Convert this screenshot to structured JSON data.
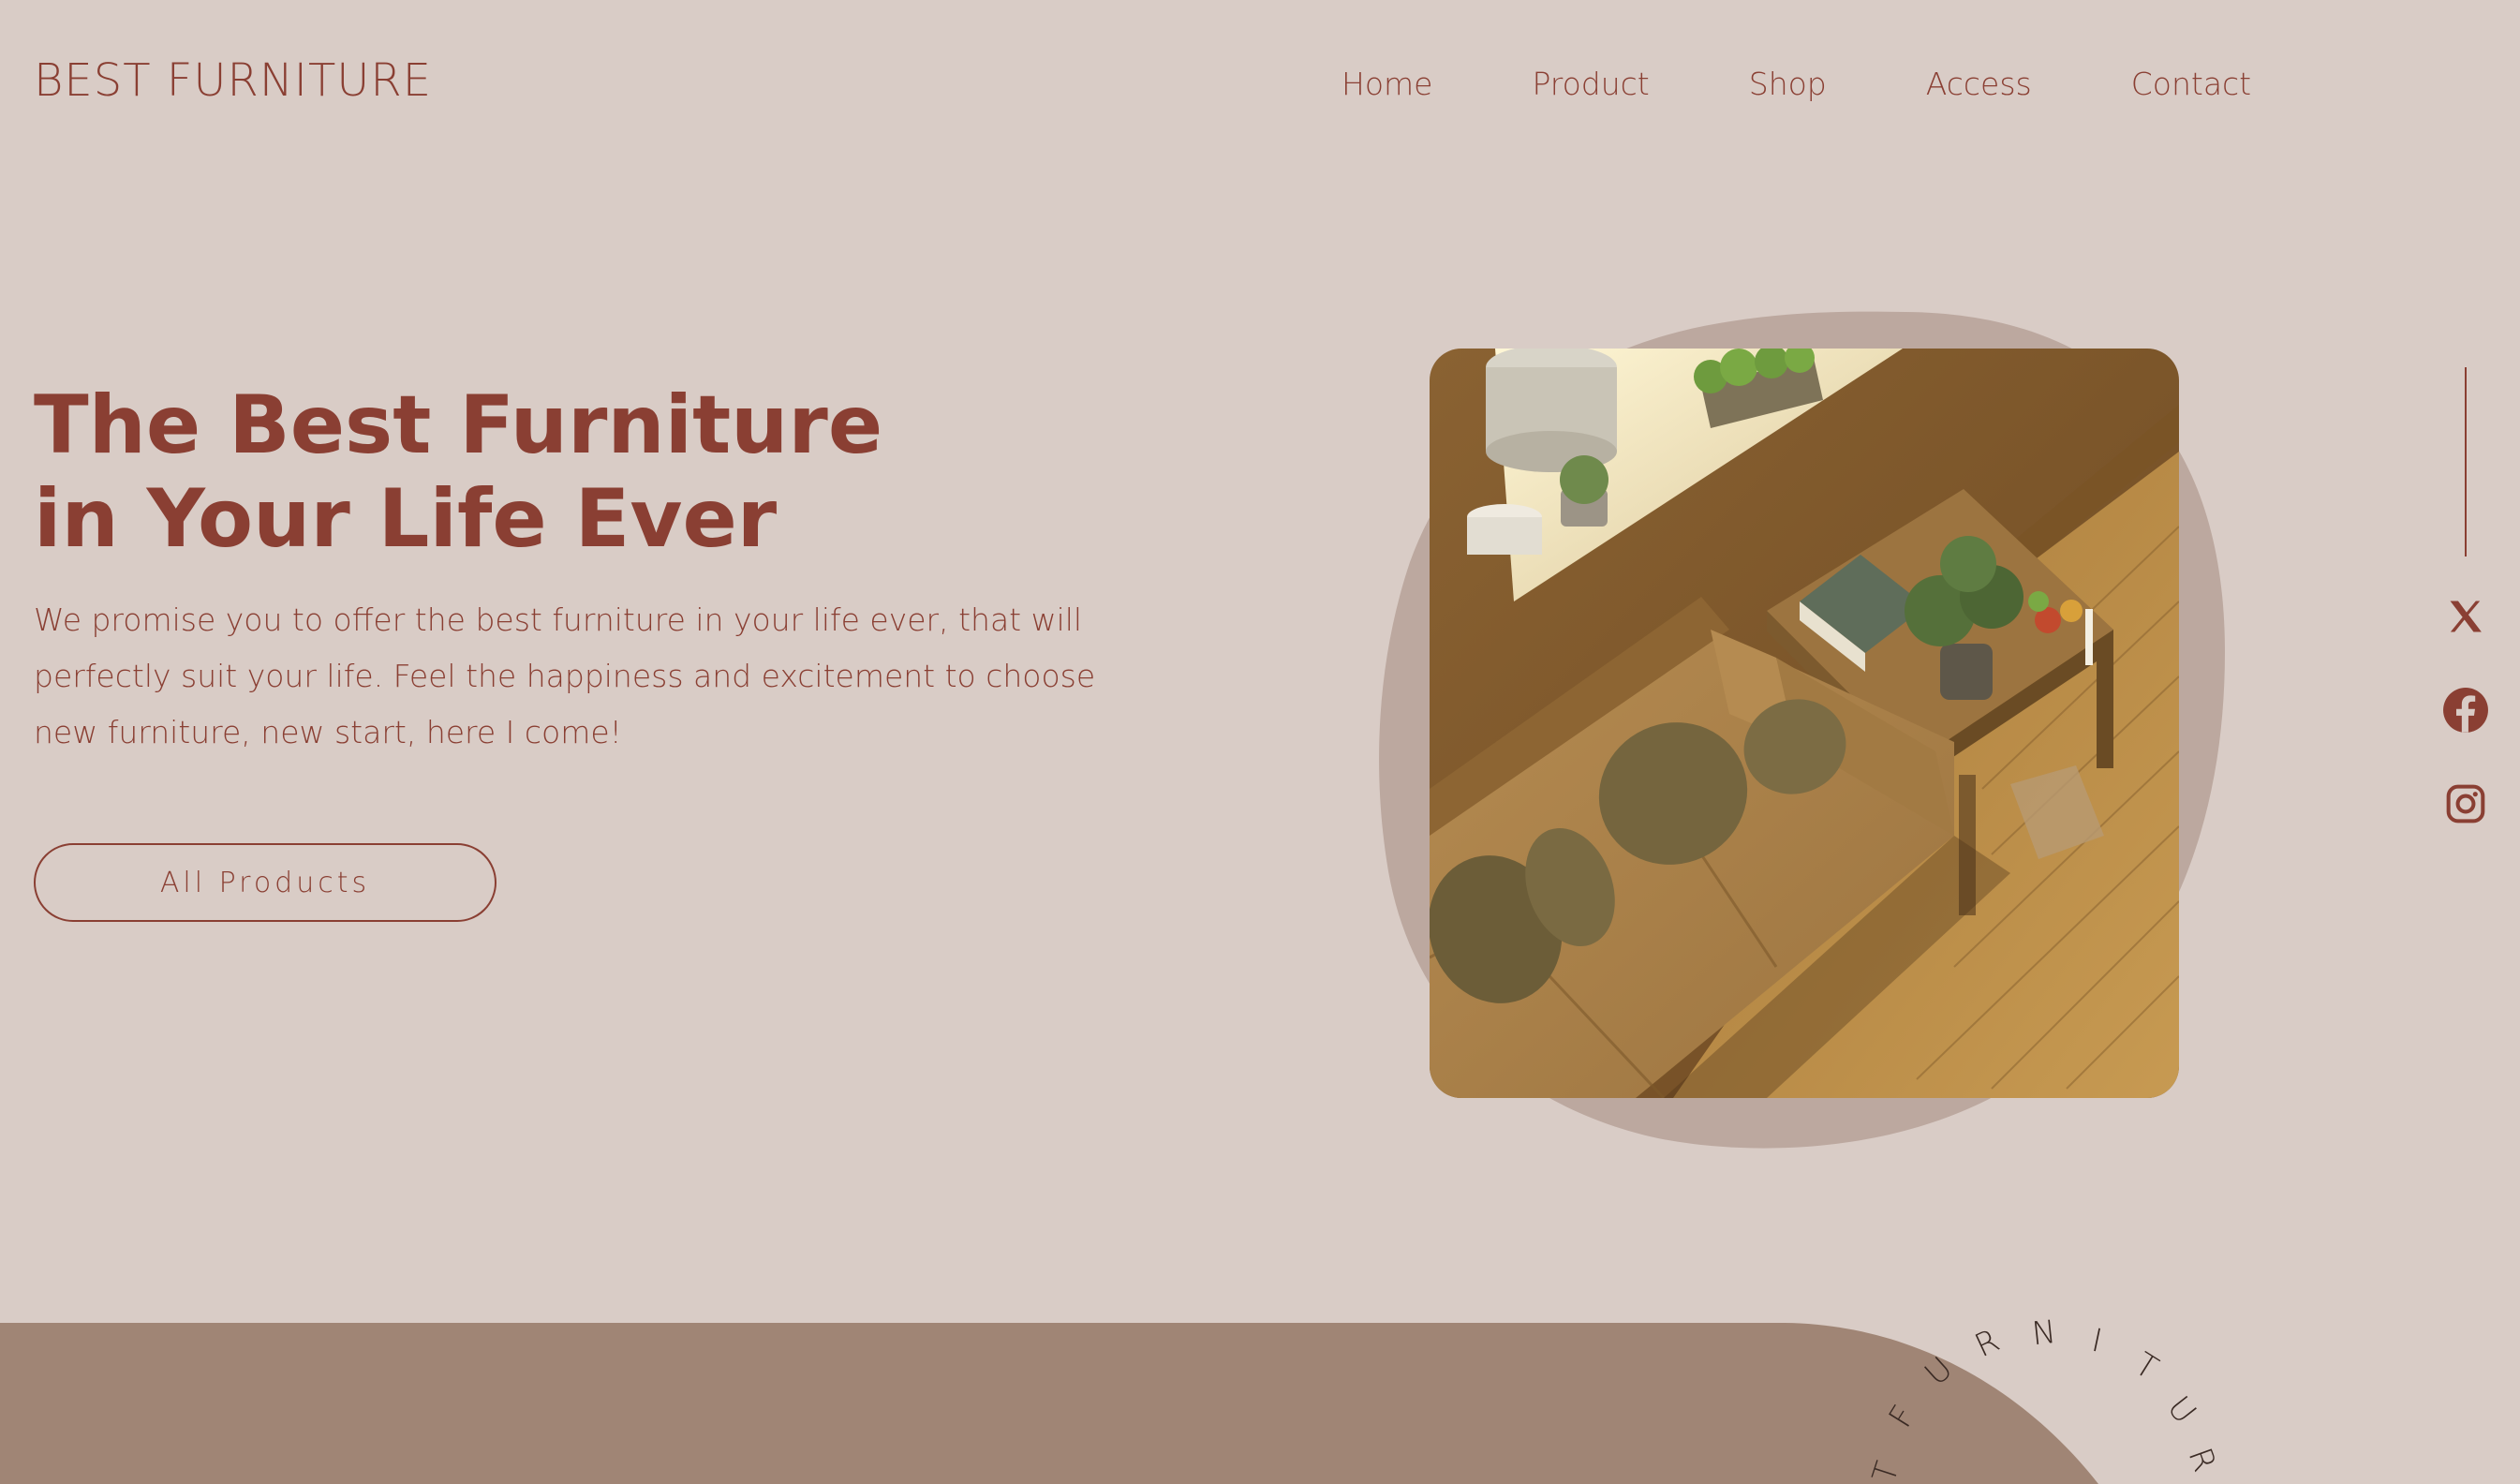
{
  "brand": {
    "name": "BEST FURNITURE",
    "accent_color": "#8a3f33",
    "background_color": "#d9ccc6",
    "band_color": "#a08575"
  },
  "nav": {
    "items": [
      "Home",
      "Product",
      "Shop",
      "Access",
      "Contact"
    ]
  },
  "hero": {
    "title_line1": "The Best Furniture",
    "title_line2": "in Your Life Ever",
    "description": "We promise you to offer the best furniture in your life ever, that will perfectly suit your life. Feel the happiness and excitement to choose new furniture, new start, here I come!",
    "cta_label": "All Products",
    "image_subject": "living-room-sofa-and-table-photo"
  },
  "social": {
    "icons": [
      "x-icon",
      "facebook-icon",
      "instagram-icon"
    ]
  },
  "footer_decor": {
    "ring_letters": [
      "T",
      "F",
      "U",
      "R",
      "N",
      "I",
      "T",
      "U",
      "R"
    ]
  }
}
